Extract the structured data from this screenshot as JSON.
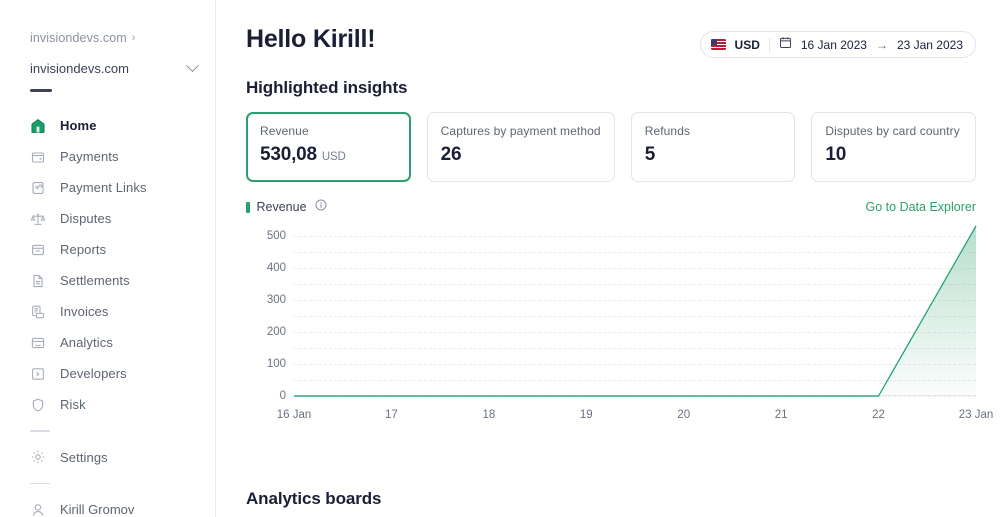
{
  "sidebar": {
    "breadcrumb": {
      "org": "invisiondevs.com",
      "chevron": "›"
    },
    "account": {
      "name": "invisiondevs.com"
    },
    "items": [
      {
        "label": "Home",
        "icon": "home-icon",
        "active": true
      },
      {
        "label": "Payments",
        "icon": "payments-icon",
        "active": false
      },
      {
        "label": "Payment Links",
        "icon": "payment-links-icon",
        "active": false
      },
      {
        "label": "Disputes",
        "icon": "disputes-icon",
        "active": false
      },
      {
        "label": "Reports",
        "icon": "reports-icon",
        "active": false
      },
      {
        "label": "Settlements",
        "icon": "settlements-icon",
        "active": false
      },
      {
        "label": "Invoices",
        "icon": "invoices-icon",
        "active": false
      },
      {
        "label": "Analytics",
        "icon": "analytics-icon",
        "active": false
      },
      {
        "label": "Developers",
        "icon": "developers-icon",
        "active": false
      },
      {
        "label": "Risk",
        "icon": "risk-icon",
        "active": false
      }
    ],
    "settings": {
      "label": "Settings",
      "icon": "gear-icon"
    },
    "user": {
      "label": "Kirill Gromov",
      "icon": "user-icon"
    }
  },
  "header": {
    "title": "Hello Kirill!",
    "currency": "USD",
    "date_from": "16 Jan 2023",
    "date_to": "23 Jan 2023",
    "date_arrow": "→"
  },
  "insights": {
    "title": "Highlighted insights",
    "cards": [
      {
        "label": "Revenue",
        "value": "530,08",
        "unit": "USD",
        "selected": true
      },
      {
        "label": "Captures by payment method",
        "value": "26",
        "unit": "",
        "selected": false
      },
      {
        "label": "Refunds",
        "value": "5",
        "unit": "",
        "selected": false
      },
      {
        "label": "Disputes by card country",
        "value": "10",
        "unit": "",
        "selected": false
      }
    ]
  },
  "chart_header": {
    "legend_label": "Revenue",
    "info_icon": "info-icon",
    "link": "Go to Data Explorer"
  },
  "boards": {
    "title": "Analytics boards"
  },
  "colors": {
    "accent_green": "#2f9e6e",
    "text_dark": "#1a1f36",
    "text_muted": "#6a7180",
    "border": "#e2e5ea"
  },
  "chart_data": {
    "type": "area",
    "title": "Revenue",
    "xlabel": "",
    "ylabel": "",
    "x": [
      "16 Jan",
      "17",
      "18",
      "19",
      "20",
      "21",
      "22",
      "23 Jan"
    ],
    "series": [
      {
        "name": "Revenue",
        "values": [
          0,
          0,
          0,
          0,
          0,
          0,
          0,
          530.08
        ],
        "color": "#2f9e6e"
      }
    ],
    "ylim": [
      0,
      530
    ],
    "yticks": [
      0,
      100,
      200,
      300,
      400,
      500
    ],
    "ytick_labels": [
      "0",
      "100",
      "200",
      "300",
      "400",
      "500"
    ],
    "gridlines": [
      0,
      50,
      100,
      150,
      200,
      250,
      300,
      350,
      400,
      450,
      500
    ],
    "grid": true,
    "grid_style": "dashed-horizontal",
    "legend": "top-left",
    "fill": "gradient-green"
  }
}
